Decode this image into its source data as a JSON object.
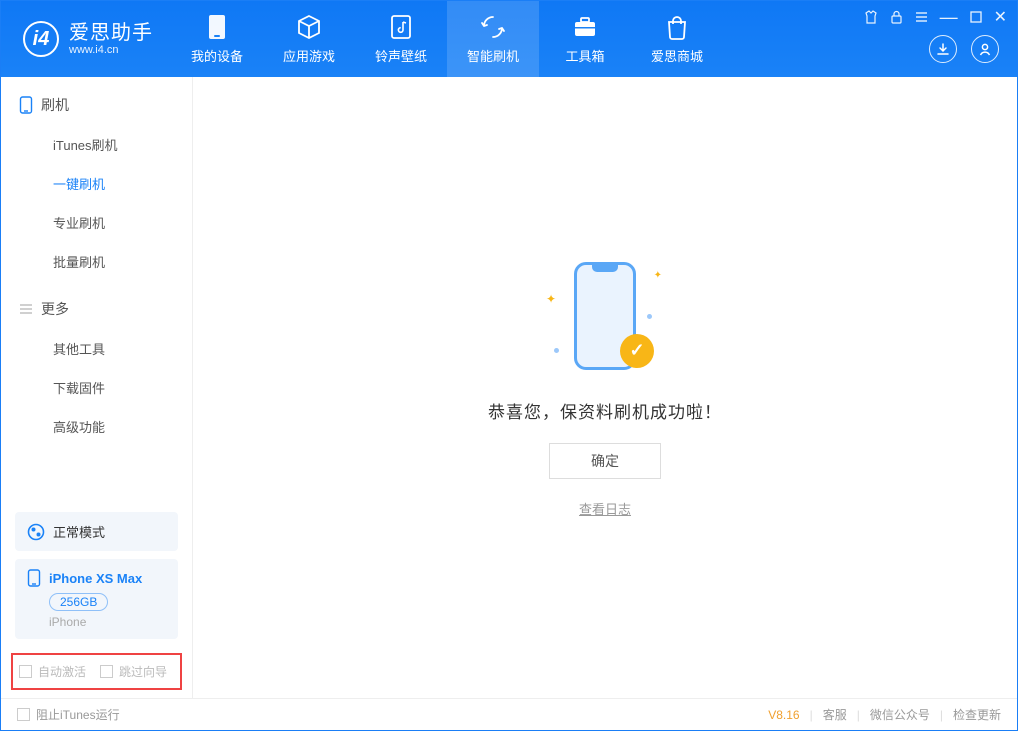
{
  "app": {
    "name": "爱思助手",
    "url": "www.i4.cn"
  },
  "nav": {
    "tabs": [
      {
        "label": "我的设备"
      },
      {
        "label": "应用游戏"
      },
      {
        "label": "铃声壁纸"
      },
      {
        "label": "智能刷机"
      },
      {
        "label": "工具箱"
      },
      {
        "label": "爱思商城"
      }
    ],
    "active_index": 3
  },
  "sidebar": {
    "section1": {
      "title": "刷机",
      "items": [
        "iTunes刷机",
        "一键刷机",
        "专业刷机",
        "批量刷机"
      ],
      "active_index": 1
    },
    "section2": {
      "title": "更多",
      "items": [
        "其他工具",
        "下载固件",
        "高级功能"
      ]
    },
    "mode": {
      "label": "正常模式"
    },
    "device": {
      "name": "iPhone XS Max",
      "capacity": "256GB",
      "type": "iPhone"
    },
    "options": {
      "auto_activate": "自动激活",
      "skip_guide": "跳过向导"
    }
  },
  "main": {
    "success_text": "恭喜您，保资料刷机成功啦！",
    "ok_button": "确定",
    "view_log": "查看日志"
  },
  "footer": {
    "block_itunes": "阻止iTunes运行",
    "version": "V8.16",
    "links": [
      "客服",
      "微信公众号",
      "检查更新"
    ]
  }
}
